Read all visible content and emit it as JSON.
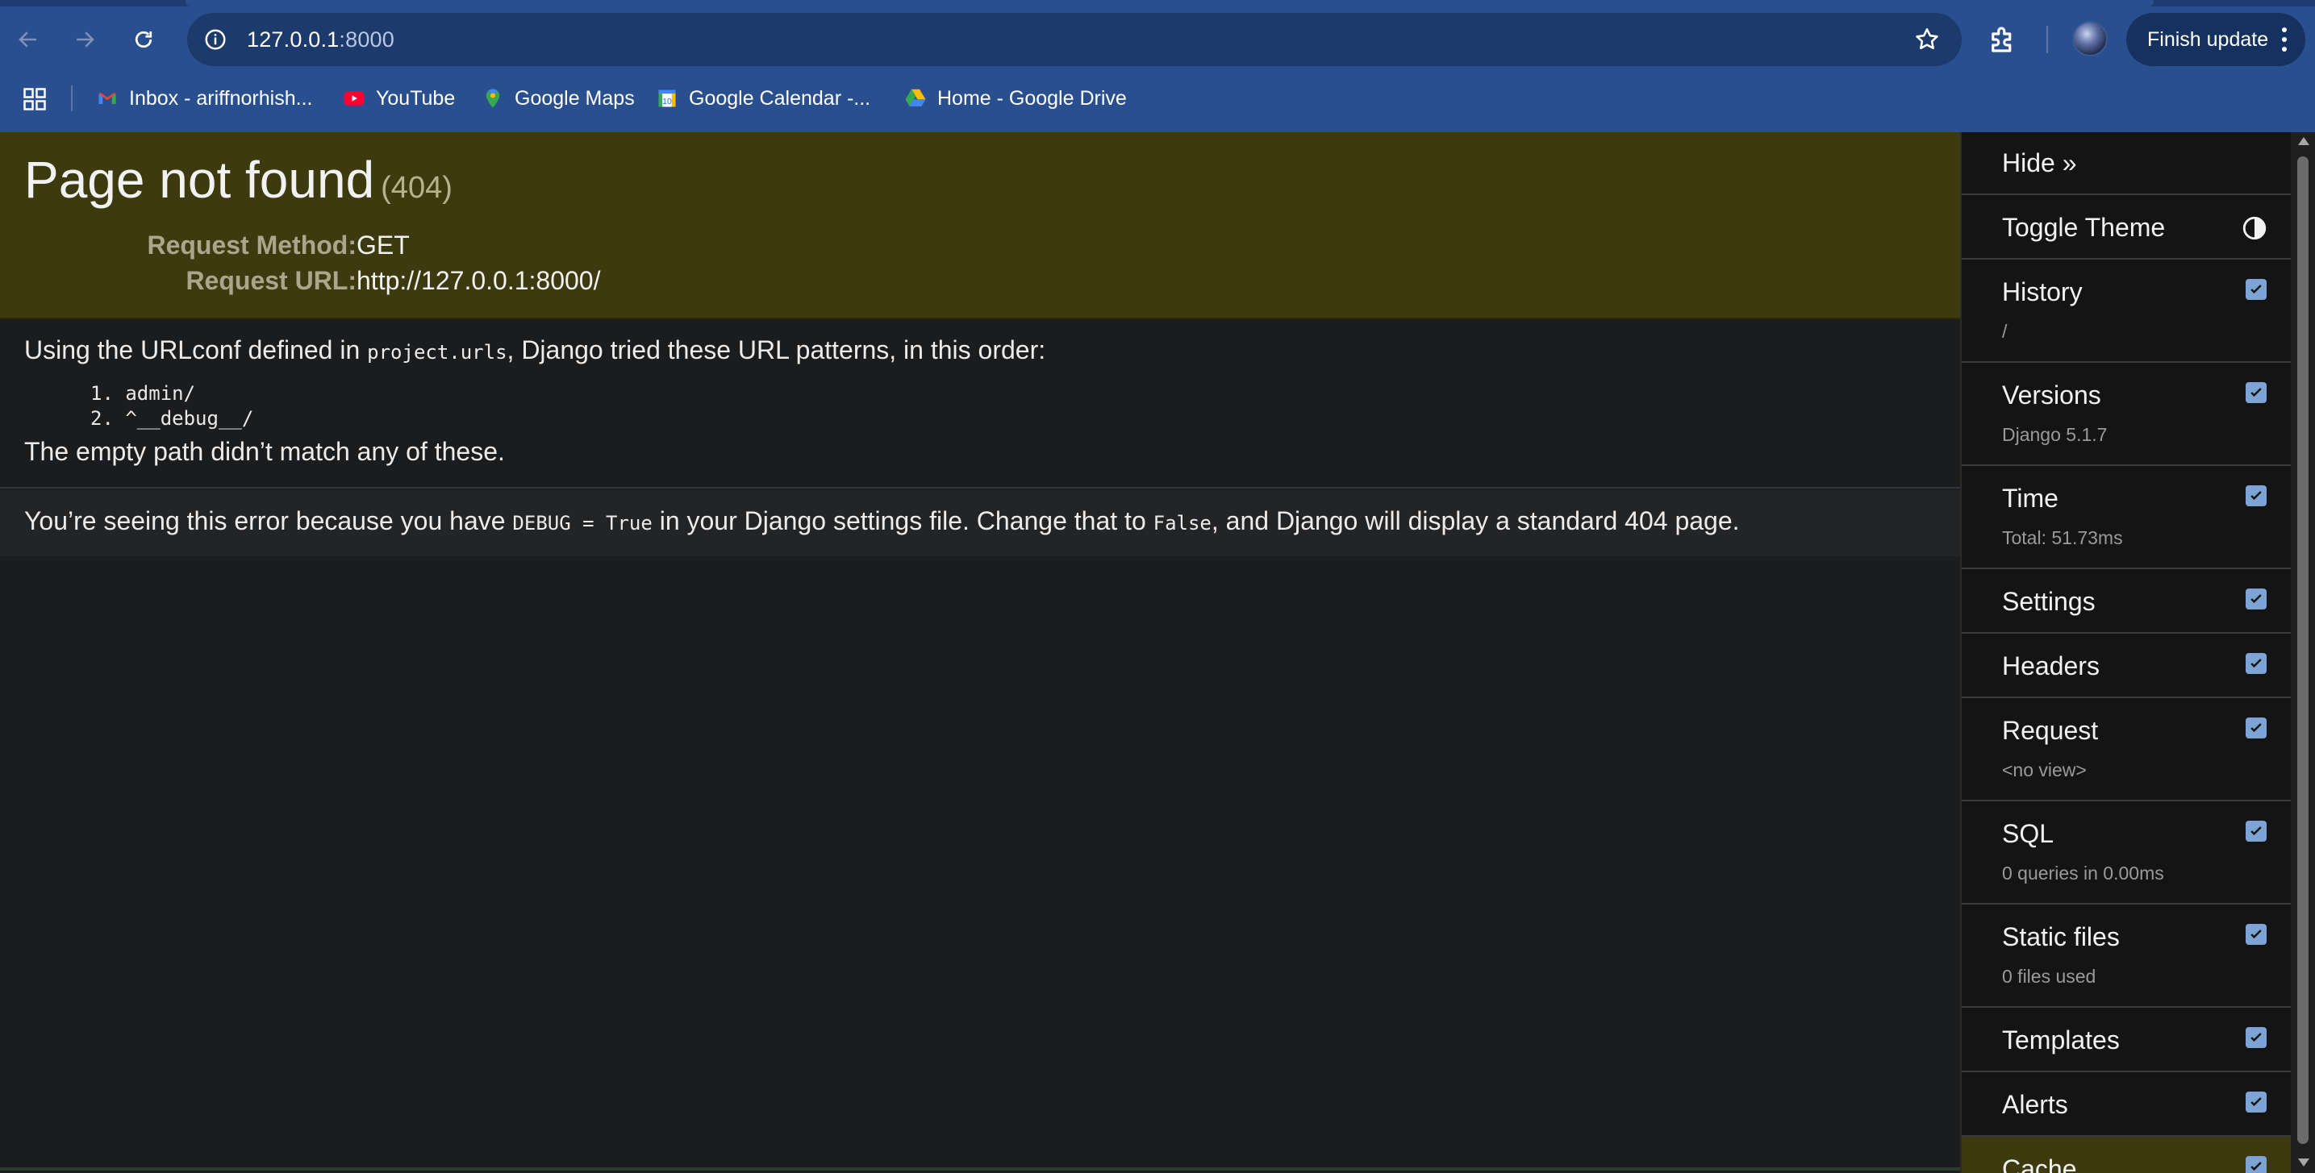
{
  "browser": {
    "url_host": "127.0.0.1",
    "url_port": ":8000",
    "finish_update_label": "Finish update",
    "bookmarks": [
      {
        "label": "Inbox - ariffnorhish...",
        "icon": "gmail-icon"
      },
      {
        "label": "YouTube",
        "icon": "youtube-icon"
      },
      {
        "label": "Google Maps",
        "icon": "google-maps-icon"
      },
      {
        "label": "Google Calendar -...",
        "icon": "google-calendar-icon"
      },
      {
        "label": "Home - Google Drive",
        "icon": "google-drive-icon"
      }
    ]
  },
  "page": {
    "title": "Page not found",
    "status_code": "(404)",
    "request_method_label": "Request Method:",
    "request_method": "GET",
    "request_url_label": "Request URL:",
    "request_url": "http://127.0.0.1:8000/",
    "urlconf_text_before": "Using the URLconf defined in ",
    "urlconf_module": "project.urls",
    "urlconf_text_after": ", Django tried these URL patterns, in this order:",
    "patterns": [
      "1.  admin/",
      "2.  ^__debug__/"
    ],
    "no_match": "The empty path didn’t match any of these.",
    "explain_1": "You’re seeing this error because you have ",
    "explain_code_1": "DEBUG = True",
    "explain_2": " in your Django settings file. Change that to ",
    "explain_code_2": "False",
    "explain_3": ", and Django will display a standard 404 page."
  },
  "toolbar": {
    "hide": "Hide »",
    "toggle_theme": "Toggle Theme",
    "panels": [
      {
        "label": "History",
        "sub": "/",
        "checked": true
      },
      {
        "label": "Versions",
        "sub": "Django 5.1.7",
        "checked": true
      },
      {
        "label": "Time",
        "sub": "Total: 51.73ms",
        "checked": true
      },
      {
        "label": "Settings",
        "sub": "",
        "checked": true
      },
      {
        "label": "Headers",
        "sub": "",
        "checked": true
      },
      {
        "label": "Request",
        "sub": "<no view>",
        "checked": true
      },
      {
        "label": "SQL",
        "sub": "0 queries in 0.00ms",
        "checked": true
      },
      {
        "label": "Static files",
        "sub": "0 files used",
        "checked": true
      },
      {
        "label": "Templates",
        "sub": "",
        "checked": true
      },
      {
        "label": "Alerts",
        "sub": "",
        "checked": true
      },
      {
        "label": "Cache",
        "sub": "",
        "checked": true
      }
    ]
  }
}
